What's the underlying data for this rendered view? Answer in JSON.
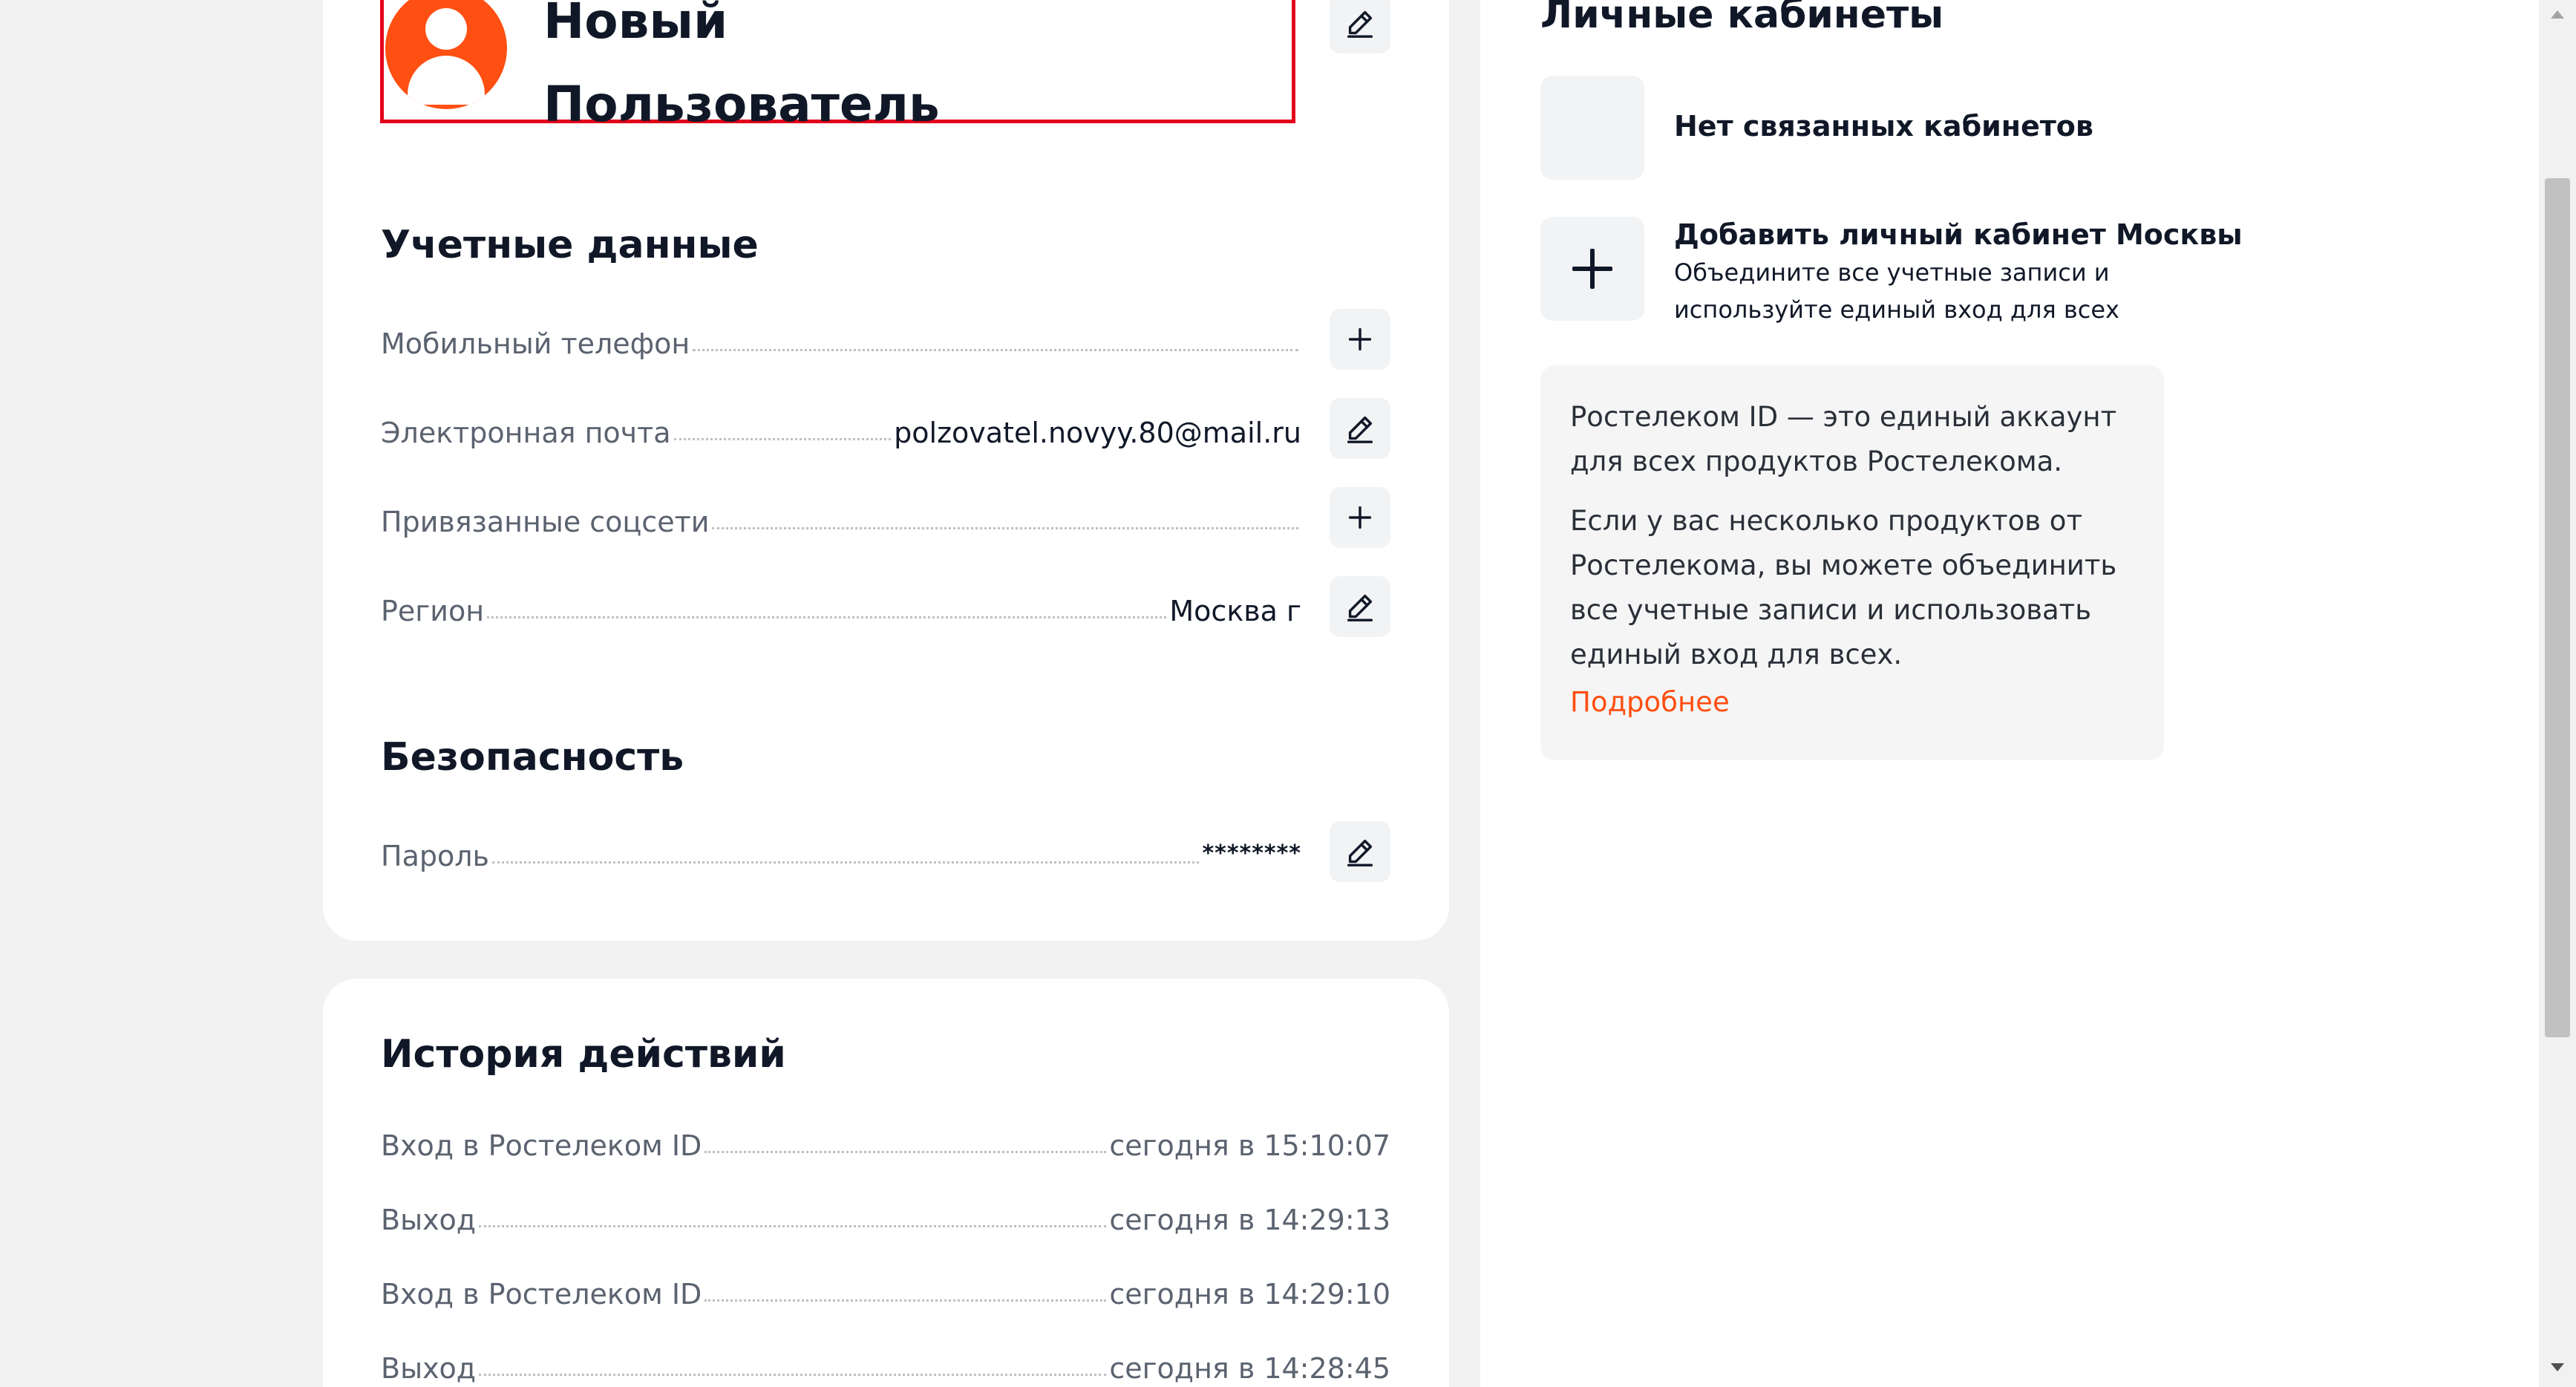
{
  "profile": {
    "name_line1": "Новый",
    "name_line2": "Пользователь",
    "avatar_icon": "user-avatar-icon",
    "edit_icon": "pencil-icon",
    "avatar_color": "#ff4f12",
    "highlight_color": "#e3001b"
  },
  "credentials": {
    "title": "Учетные данные",
    "rows": [
      {
        "label": "Мобильный телефон",
        "value": "",
        "action_icon": "plus-icon"
      },
      {
        "label": "Электронная почта",
        "value": "polzovatel.novyy.80@mail.ru",
        "action_icon": "pencil-icon"
      },
      {
        "label": "Привязанные соцсети",
        "value": "",
        "action_icon": "plus-icon"
      },
      {
        "label": "Регион",
        "value": "Москва г",
        "action_icon": "pencil-icon"
      }
    ]
  },
  "security": {
    "title": "Безопасность",
    "rows": [
      {
        "label": "Пароль",
        "value": "********",
        "action_icon": "pencil-icon"
      }
    ]
  },
  "history": {
    "title": "История действий",
    "rows": [
      {
        "label": "Вход в Ростелеком ID",
        "value": "сегодня в 15:10:07"
      },
      {
        "label": "Выход",
        "value": "сегодня в 14:29:13"
      },
      {
        "label": "Вход в Ростелеком ID",
        "value": "сегодня в 14:29:10"
      },
      {
        "label": "Выход",
        "value": "сегодня в 14:28:45"
      }
    ]
  },
  "cabinets": {
    "title": "Личные кабинеты",
    "no_linked": "Нет связанных кабинетов",
    "add_title": "Добавить личный кабинет Москвы",
    "add_subtitle_line1": "Объедините все учетные записи и",
    "add_subtitle_line2": "используйте единый вход для всех",
    "add_icon": "plus-icon",
    "info_p1": "Ростелеком ID — это единый аккаунт для всех продуктов Ростелекома.",
    "info_p2": "Если у вас несколько продуктов от Ростелекома, вы можете объединить все учетные записи и использовать единый вход для всех.",
    "info_link": "Подробнее",
    "link_color": "#ff4f12"
  }
}
